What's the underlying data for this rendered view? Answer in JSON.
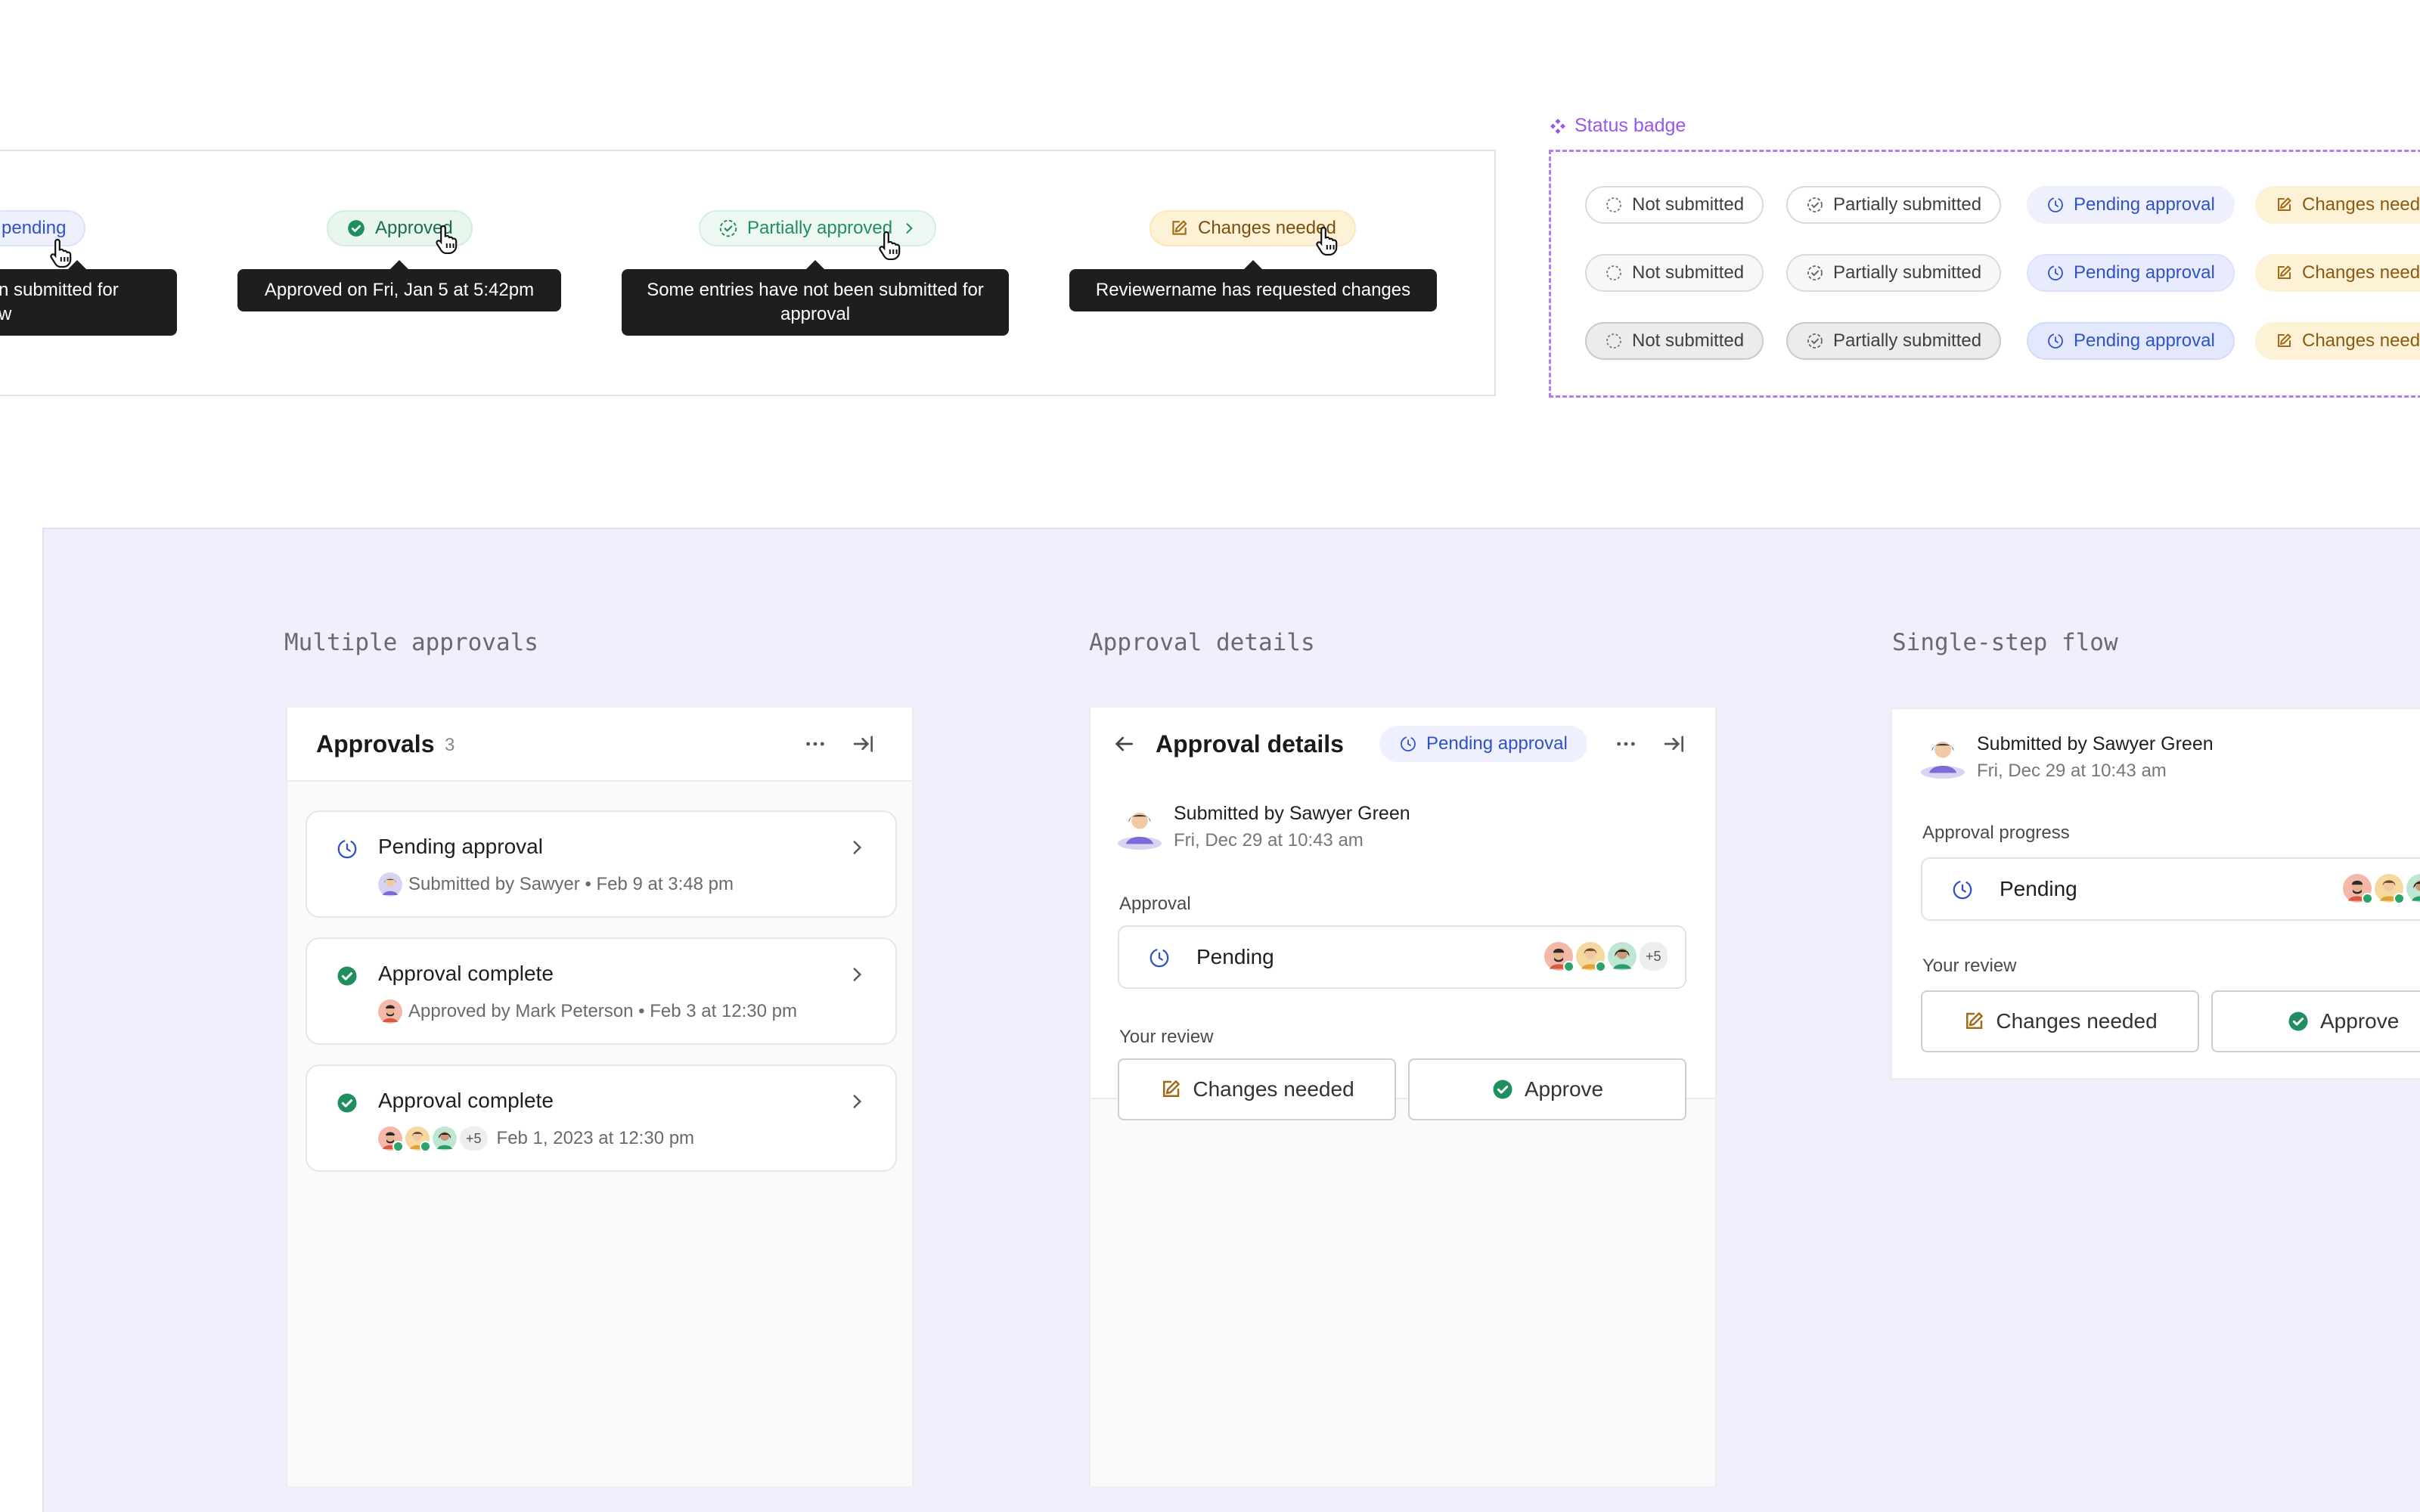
{
  "tooltips": {
    "pending_pill": "pending",
    "pending_tip": [
      "n submitted for",
      "w"
    ],
    "approved_pill": "Approved",
    "approved_tip": "Approved on Fri, Jan 5 at 5:42pm",
    "partial_pill": "Partially approved",
    "partial_tip": "Some entries have not been submitted for approval",
    "changes_pill": "Changes needed",
    "changes_tip": "Reviewername has requested changes"
  },
  "status_badge": {
    "label": "Status badge",
    "rows": [
      [
        "Not submitted",
        "Partially submitted",
        "Pending approval",
        "Changes need"
      ],
      [
        "Not submitted",
        "Partially submitted",
        "Pending approval",
        "Changes need"
      ],
      [
        "Not submitted",
        "Partially submitted",
        "Pending approval",
        "Changes need"
      ]
    ]
  },
  "sections": {
    "multiple": "Multiple approvals",
    "details": "Approval details",
    "single": "Single-step flow"
  },
  "approvals_panel": {
    "title": "Approvals",
    "count": "3",
    "cards": [
      {
        "title": "Pending approval",
        "sub": "Submitted by Sawyer • Feb 9 at 3:48 pm"
      },
      {
        "title": "Approval complete",
        "sub": "Approved by Mark Peterson • Feb 3 at 12:30 pm"
      },
      {
        "title": "Approval complete",
        "sub": "Feb 1, 2023 at 12:30 pm",
        "more": "+5"
      }
    ]
  },
  "details_panel": {
    "title": "Approval details",
    "badge": "Pending approval",
    "submitter": "Submitted by Sawyer Green",
    "date": "Fri, Dec 29 at 10:43 am",
    "approval_label": "Approval",
    "status": "Pending",
    "more": "+5",
    "review_label": "Your review",
    "changes_btn": "Changes needed",
    "approve_btn": "Approve"
  },
  "single_panel": {
    "submitter": "Submitted by Sawyer Green",
    "date": "Fri, Dec 29 at 10:43 am",
    "progress_label": "Approval progress",
    "status": "Pending",
    "review_label": "Your review",
    "changes_btn": "Changes needed",
    "approve_btn": "Approve"
  },
  "colors": {
    "pending_blue": "#2f52c7",
    "approved_green": "#1f8f5f",
    "changes_amber": "#8a5a12",
    "accent_purple": "#9b55e8"
  }
}
